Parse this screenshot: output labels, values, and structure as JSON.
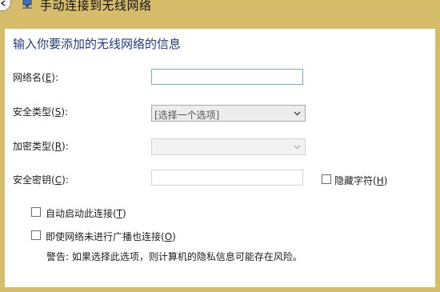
{
  "window": {
    "title": "手动连接到无线网络"
  },
  "form": {
    "heading": "输入你要添加的无线网络的信息",
    "network_name": {
      "label_prefix": "网络名(",
      "access_key": "E",
      "label_suffix": "):",
      "value": ""
    },
    "security_type": {
      "label_prefix": "安全类型(",
      "access_key": "S",
      "label_suffix": "):",
      "selected": "[选择一个选项]"
    },
    "encryption_type": {
      "label_prefix": "加密类型(",
      "access_key": "R",
      "label_suffix": "):",
      "selected": ""
    },
    "security_key": {
      "label_prefix": "安全密钥(",
      "access_key": "C",
      "label_suffix": "):",
      "value": ""
    },
    "hide_characters": {
      "label_prefix": "隐藏字符(",
      "access_key": "H",
      "label_suffix": ")",
      "checked": false
    },
    "auto_connect": {
      "label_prefix": "自动启动此连接(",
      "access_key": "T",
      "label_suffix": ")",
      "checked": false
    },
    "connect_if_not_broadcasting": {
      "label_prefix": "即使网络未进行广播也连接(",
      "access_key": "O",
      "label_suffix": ")",
      "checked": false
    },
    "warning": "警告: 如果选择此选项，则计算机的隐私信息可能存在风险。"
  },
  "icons": {
    "back": "back-arrow-icon",
    "network": "wireless-network-icon",
    "dropdown": "chevron-down-icon"
  },
  "colors": {
    "window_frame": "#d6bd6b",
    "heading": "#1e3c8c"
  }
}
